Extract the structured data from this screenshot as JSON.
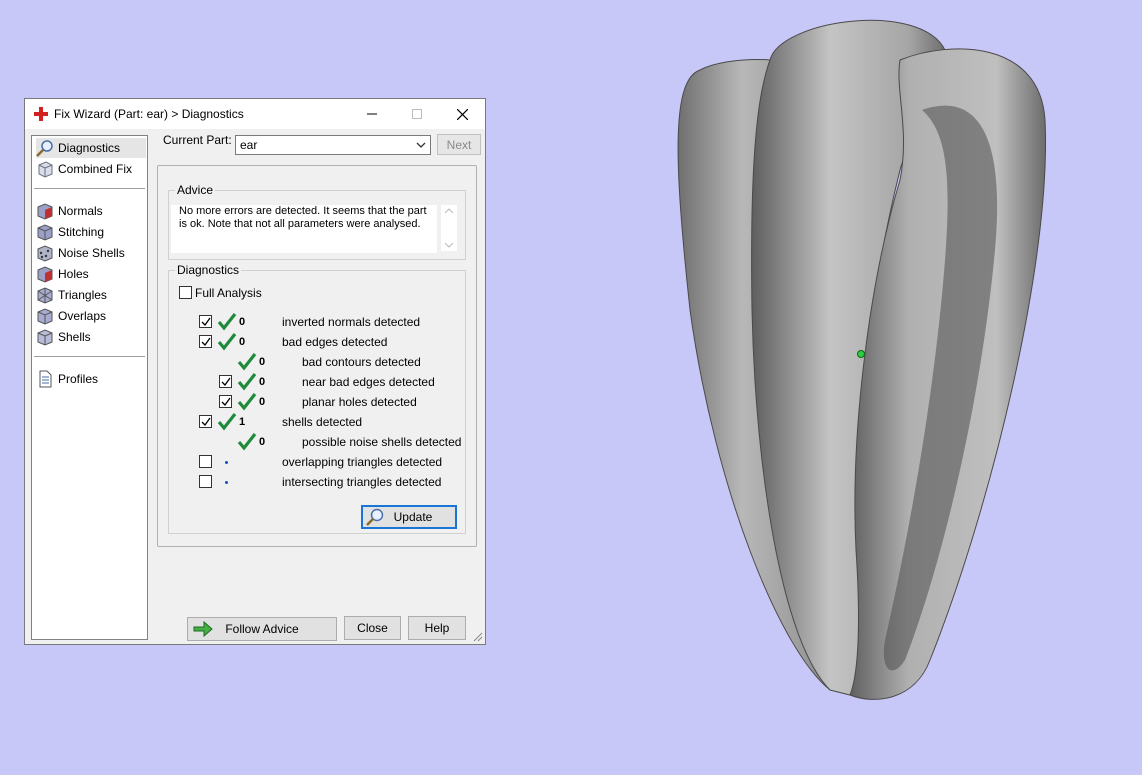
{
  "window": {
    "title": "Fix Wizard (Part: ear) > Diagnostics",
    "icon": "red-cross-icon",
    "minimize": "─",
    "maximize": "☐",
    "close": "✕"
  },
  "sidebar": {
    "items": [
      {
        "label": "Diagnostics",
        "icon": "magnifier-icon",
        "selected": true
      },
      {
        "label": "Combined Fix",
        "icon": "cube-outline-icon"
      },
      {
        "label": "Normals",
        "icon": "normals-cube-icon"
      },
      {
        "label": "Stitching",
        "icon": "stitching-cube-icon"
      },
      {
        "label": "Noise Shells",
        "icon": "noise-shells-icon"
      },
      {
        "label": "Holes",
        "icon": "holes-cube-icon"
      },
      {
        "label": "Triangles",
        "icon": "triangles-cube-icon"
      },
      {
        "label": "Overlaps",
        "icon": "overlaps-cube-icon"
      },
      {
        "label": "Shells",
        "icon": "shells-cube-icon"
      },
      {
        "label": "Profiles",
        "icon": "document-icon"
      }
    ]
  },
  "current_part": {
    "label": "Current Part:",
    "value": "ear",
    "next_label": "Next"
  },
  "advice": {
    "group_label": "Advice",
    "text": "No more errors are detected. It seems that the part is ok. Note that not all parameters were analysed."
  },
  "diagnostics": {
    "group_label": "Diagnostics",
    "full_analysis_label": "Full Analysis",
    "rows": [
      {
        "checked": true,
        "status": "ok",
        "count": "0",
        "label": "inverted normals detected"
      },
      {
        "checked": true,
        "status": "ok",
        "count": "0",
        "label": "bad edges detected"
      },
      {
        "checked": null,
        "status": "ok",
        "count": "0",
        "label": "bad contours detected"
      },
      {
        "checked": true,
        "status": "ok",
        "count": "0",
        "label": "near bad edges detected"
      },
      {
        "checked": true,
        "status": "ok",
        "count": "0",
        "label": "planar holes detected"
      },
      {
        "checked": true,
        "status": "ok",
        "count": "1",
        "label": "shells detected"
      },
      {
        "checked": null,
        "status": "ok",
        "count": "0",
        "label": "possible noise shells detected"
      },
      {
        "checked": false,
        "status": "not-run",
        "count": "",
        "label": "overlapping triangles detected"
      },
      {
        "checked": false,
        "status": "not-run",
        "count": "",
        "label": "intersecting triangles detected"
      }
    ],
    "update_label": "Update"
  },
  "footer": {
    "follow_advice_label": "Follow Advice",
    "close_label": "Close",
    "help_label": "Help"
  },
  "colors": {
    "viewport_bg": "#c8c8f8",
    "check_green": "#1f8a3b",
    "focus_blue": "#1874d6"
  }
}
